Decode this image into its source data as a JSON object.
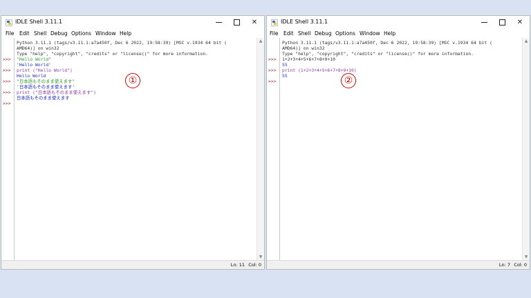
{
  "window1": {
    "title": "IDLE Shell 3.11.1",
    "menu": [
      "File",
      "Edit",
      "Shell",
      "Debug",
      "Options",
      "Window",
      "Help"
    ],
    "lines": [
      {
        "prompt": "",
        "text": "Python 3.11.1 (tags/v3.11.1:a7a450f, Dec  6 2022, 19:58:39) [MSC v.1934 64 bit (",
        "color": "out"
      },
      {
        "prompt": "",
        "text": "AMD64)] on win32",
        "color": "out"
      },
      {
        "prompt": "",
        "text": "Type \"help\", \"copyright\", \"credits\" or \"license()\" for more information.",
        "color": "out"
      },
      {
        "prompt": ">>>",
        "text": "\"Hello World\"",
        "color": "str"
      },
      {
        "prompt": "",
        "text": "'Hello World'",
        "color": "res"
      },
      {
        "prompt": ">>>",
        "text": "print (\"Hello World\")",
        "color": "kw"
      },
      {
        "prompt": "",
        "text": "Hello World",
        "color": "res"
      },
      {
        "prompt": ">>>",
        "text": "\"日本語もそのまま使えます\"",
        "color": "str"
      },
      {
        "prompt": "",
        "text": "'日本語もそのまま使えます'",
        "color": "res"
      },
      {
        "prompt": ">>>",
        "text": "print (\"日本語もそのまま使えます\")",
        "color": "kw"
      },
      {
        "prompt": "",
        "text": "日本語もそのまま使えます",
        "color": "res"
      },
      {
        "prompt": ">>>",
        "text": "",
        "color": "out"
      }
    ],
    "status": {
      "ln": "Ln: 11",
      "col": "Col: 0"
    },
    "marker": "①"
  },
  "window2": {
    "title": "IDLE Shell 3.11.1",
    "menu": [
      "File",
      "Edit",
      "Shell",
      "Debug",
      "Options",
      "Window",
      "Help"
    ],
    "lines": [
      {
        "prompt": "",
        "text": "Python 3.11.1 (tags/v3.11.1:a7a450f, Dec  6 2022, 19:58:39) [MSC v.1934 64 bit (",
        "color": "out"
      },
      {
        "prompt": "",
        "text": "AMD64)] on win32",
        "color": "out"
      },
      {
        "prompt": "",
        "text": "Type \"help\", \"copyright\", \"credits\" or \"license()\" for more information.",
        "color": "out"
      },
      {
        "prompt": ">>>",
        "text": "1+2+3+4+5+6+7+8+9+10",
        "color": "out"
      },
      {
        "prompt": "",
        "text": "55",
        "color": "res"
      },
      {
        "prompt": ">>>",
        "text": "print (1+2+3+4+5+6+7+8+9+10)",
        "color": "kw"
      },
      {
        "prompt": "",
        "text": "55",
        "color": "res"
      },
      {
        "prompt": ">>>",
        "text": "",
        "color": "out"
      }
    ],
    "status": {
      "ln": "Ln: 7",
      "col": "Col: 0"
    },
    "marker": "②"
  },
  "colors": {
    "background": "#d9e2f3",
    "prompt": "#a0262a",
    "string": "#2a9d2a",
    "keyword": "#8d3ba8",
    "result": "#1e2ac8",
    "marker": "#d00000"
  },
  "icons": {
    "app": "idle-python-icon",
    "minimize": "minimize-icon",
    "maximize": "maximize-icon",
    "close": "close-icon",
    "scroll_up": "scroll-up-arrow-icon",
    "scroll_down": "scroll-down-arrow-icon"
  }
}
